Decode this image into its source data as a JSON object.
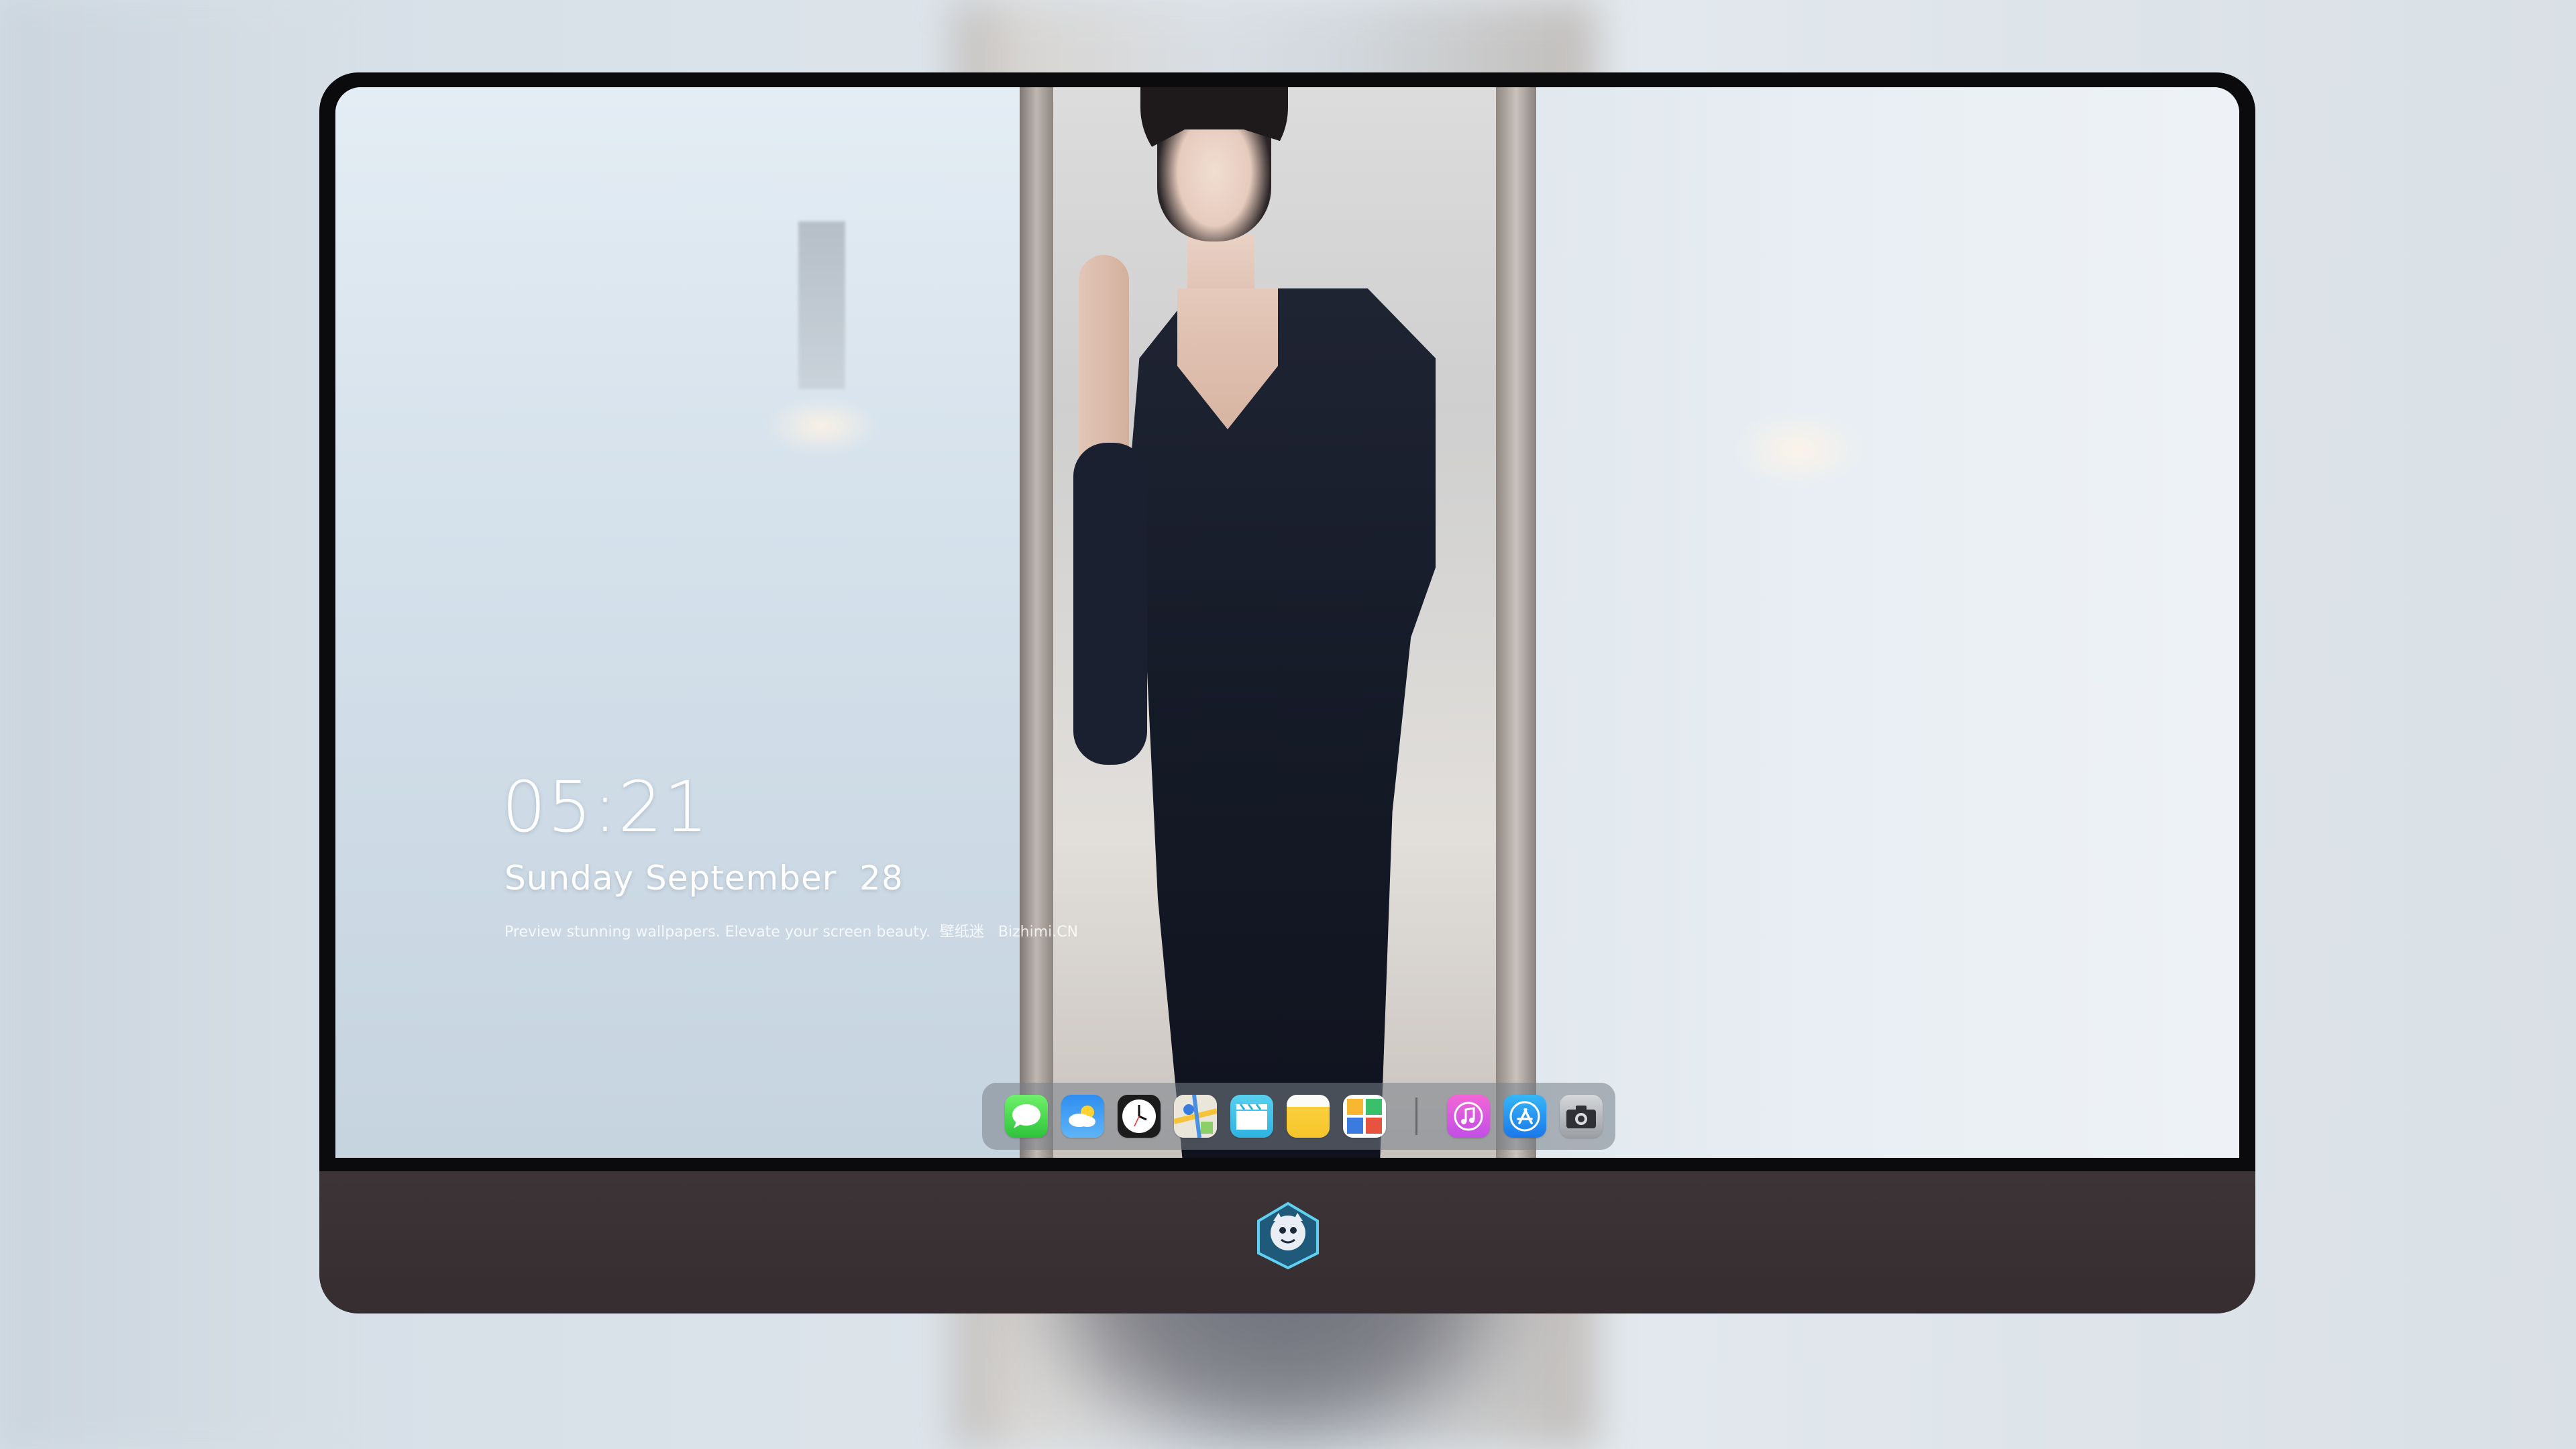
{
  "lock_screen": {
    "time": "05:21",
    "date": "Sunday September  28",
    "tagline": "Preview stunning wallpapers. Elevate your screen beauty.  壁纸迷   Bizhimi.CN"
  },
  "dock": {
    "apps": [
      {
        "name": "messages-icon"
      },
      {
        "name": "weather-icon"
      },
      {
        "name": "clock-icon"
      },
      {
        "name": "maps-icon"
      },
      {
        "name": "videos-icon"
      },
      {
        "name": "notes-icon"
      },
      {
        "name": "photos-icon"
      },
      {
        "name": "music-icon"
      },
      {
        "name": "app-store-icon"
      },
      {
        "name": "camera-icon"
      }
    ]
  },
  "colors": {
    "bezel": "#0b0b0d",
    "chin": "#3a3134",
    "dock_bg": "#78808899",
    "text": "#ffffff"
  }
}
